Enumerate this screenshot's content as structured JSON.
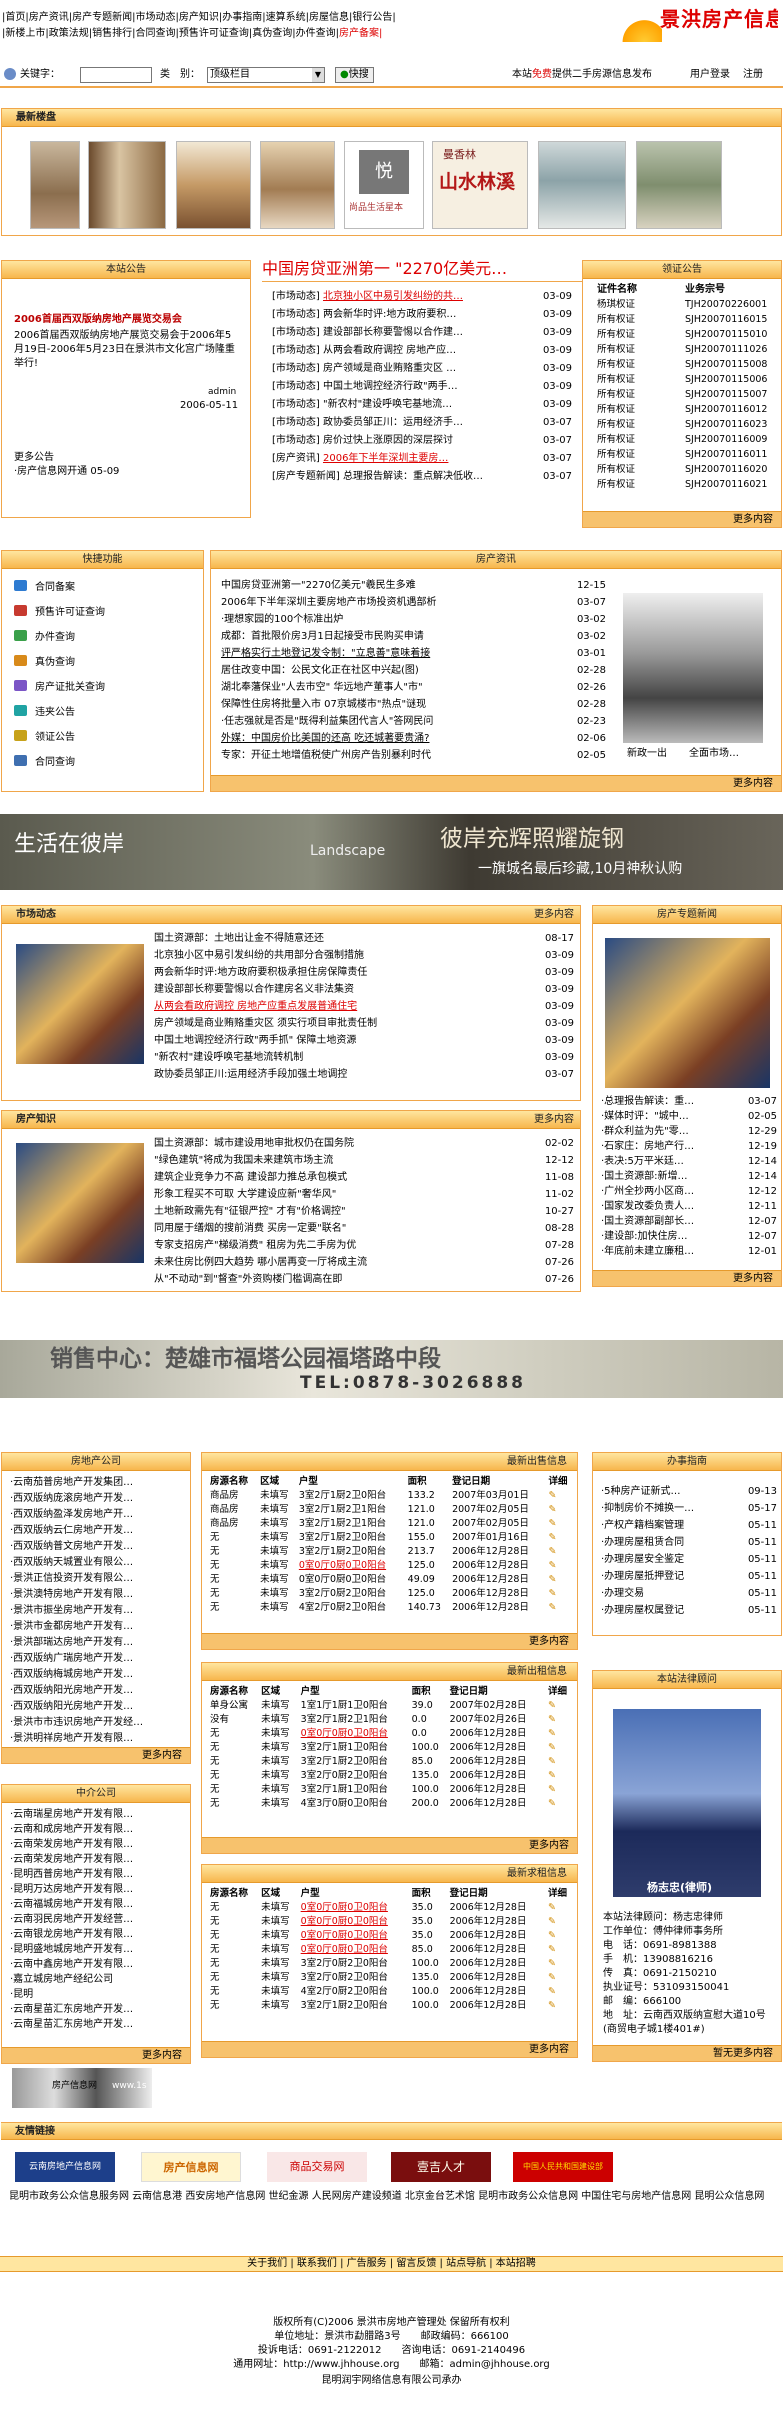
{
  "topnav": {
    "row1": "|首页|房产资讯|房产专题新闻|市场动态|房产知识|办事指南|速算系统|房屋信息|银行公告|",
    "row2": "|新楼上市|政策法规|销售排行|合同查询|预售许可证查询|真伪查询|办件查询|",
    "row2_red": "房产备案|"
  },
  "logo": {
    "text": "景洪房产信息网"
  },
  "search": {
    "keyword_label": "关键字：",
    "type_label": "类　别：",
    "select_value": "顶级栏目",
    "button": "快搜",
    "notice_pre": "本站",
    "notice_red": "免费",
    "notice_post": "提供二手房源信息发布",
    "links": [
      "用户登录",
      "注册"
    ]
  },
  "new_buildings": {
    "title": "最新楼盘",
    "ad_caption1": "尚品生活星本",
    "ad_caption2": "山水林溪",
    "ad_caption2_top": "曼香林"
  },
  "notice": {
    "title": "本站公告",
    "headline": "2006首届西双版纳房地产展览交易会",
    "text": "2006首届西双版纳房地产展览交易会于2006年5月19日-2006年5月23日在景洪市文化宫广场隆重举行!",
    "sign": "admin",
    "date": "2006-05-11",
    "more": "更多公告",
    "item": "·房产信息网开通 05-09"
  },
  "middle_news": {
    "title": "中国房贷亚洲第一 \"2270亿美元…",
    "items": [
      {
        "t": "[市场动态] ",
        "r": "北京独小区中易引发纠纷的共…",
        "d": "03-09"
      },
      {
        "t": "[市场动态] 两会新华时评:地方政府要积…",
        "r": "",
        "d": "03-09"
      },
      {
        "t": "[市场动态] 建设部部长称要警惕以合作建…",
        "r": "",
        "d": "03-09"
      },
      {
        "t": "[市场动态] 从两会看政府调控 房地产应…",
        "r": "",
        "d": "03-09"
      },
      {
        "t": "[市场动态] 房产领域是商业贿赂重灾区 …",
        "r": "",
        "d": "03-09"
      },
      {
        "t": "[市场动态] 中国土地调控经济行政\"两手…",
        "r": "",
        "d": "03-09"
      },
      {
        "t": "[市场动态] \"新农村\"建设呼唤宅基地流…",
        "r": "",
        "d": "03-09"
      },
      {
        "t": "[市场动态] 政协委员邹正川：运用经济手…",
        "r": "",
        "d": "03-07"
      },
      {
        "t": "[市场动态] 房价过快上涨原因的深层探讨",
        "r": "",
        "d": "03-07"
      },
      {
        "t": "[房产资讯] ",
        "r": "2006年下半年深圳主要房…",
        "d": "03-07"
      },
      {
        "t": "[房产专题新闻] 总理报告解读：重点解决低收…",
        "r": "",
        "d": "03-07"
      }
    ]
  },
  "certs": {
    "title": "领证公告",
    "h1": "证件名称",
    "h2": "业务宗号",
    "rows": [
      [
        "杨琪权证",
        "TJH20070226001"
      ],
      [
        "所有权证",
        "SJH20070116015"
      ],
      [
        "所有权证",
        "SJH20070115010"
      ],
      [
        "所有权证",
        "SJH20070111026"
      ],
      [
        "所有权证",
        "SJH20070115008"
      ],
      [
        "所有权证",
        "SJH20070115006"
      ],
      [
        "所有权证",
        "SJH20070115007"
      ],
      [
        "所有权证",
        "SJH20070116012"
      ],
      [
        "所有权证",
        "SJH20070116023"
      ],
      [
        "所有权证",
        "SJH20070116009"
      ],
      [
        "所有权证",
        "SJH20070116011"
      ],
      [
        "所有权证",
        "SJH20070116020"
      ],
      [
        "所有权证",
        "SJH20070116021"
      ]
    ],
    "more": "更多内容"
  },
  "quick": {
    "title": "快捷功能",
    "items": [
      "合同备案",
      "预售许可证查询",
      "办件查询",
      "真伪查询",
      "房产证批关查询",
      "违夹公告",
      "领证公告",
      "合同查询"
    ]
  },
  "fangchan_news": {
    "title": "房产资讯",
    "items": [
      {
        "t": "中国房贷亚洲第一\"2270亿美元\"羲民生多难",
        "d": "12-15"
      },
      {
        "t": "2006年下半年深圳主要房地产市场投资机遇部析",
        "d": "03-07"
      },
      {
        "t": "·理想家园的100个标准出炉",
        "d": "03-02"
      },
      {
        "t": "成都：首批限价房3月1日起接受市民购买申请",
        "d": "03-02"
      },
      {
        "t": "评严格实行土地登记发令制：\"立息善\"意味着接",
        "d": "03-01"
      },
      {
        "t": "居住改变中国：公民文化正在社区中兴起(图)",
        "d": "02-28"
      },
      {
        "t": "湖北奉藩保业\"人去市空\" 华远地产董事人\"市\"",
        "d": "02-26"
      },
      {
        "t": "保障性住房将批量入市 07京城楼市\"热点\"谜现",
        "d": "02-28"
      },
      {
        "t": "·任志强就是否是\"既得利益集团代言人\"答网民问",
        "d": "02-23"
      },
      {
        "t": "外媒：中国房价比美国的还高 吃还城著要贵涌?",
        "d": "02-06"
      },
      {
        "t": "专家：开征土地增值税使广州房产告别暴利时代",
        "d": "02-05"
      }
    ],
    "captions": [
      "新政一出",
      "全面市场…"
    ],
    "more": "更多内容"
  },
  "banner1": {
    "left": "生活在彼岸",
    "mid": "Landscape",
    "right_top": "彼岸充辉照耀旋钢",
    "right_bottom": "一旗城名最后珍藏,10月神秋认购"
  },
  "market": {
    "title": "市场动态",
    "more": "更多内容",
    "items": [
      {
        "t": "国土资源部：土地出让金不得随意还还",
        "d": "08-17"
      },
      {
        "t": "北京独小区中易引发纠纷的共用部分合强制措施",
        "d": "03-09"
      },
      {
        "t": "两会新华时评:地方政府要积极承担住房保障责任",
        "d": "03-09"
      },
      {
        "t": "建设部部长称要警惕以合作建房名义非法集资",
        "d": "03-09"
      },
      {
        "t": "从两会看政府调控 房地产应重点发展普通住宅",
        "d": "03-09",
        "red": true
      },
      {
        "t": "房产领域是商业贿赂重灾区 须实行项目审批责任制",
        "d": "03-09"
      },
      {
        "t": "中国土地调控经济行政\"两手抓\" 保障土地资源",
        "d": "03-09"
      },
      {
        "t": "\"新农村\"建设呼唤宅基地流转机制",
        "d": "03-09"
      },
      {
        "t": "政协委员邹正川:运用经济手段加强土地调控",
        "d": "03-07"
      }
    ]
  },
  "special": {
    "title": "房产专题新闻",
    "items": [
      {
        "t": "·总理报告解读：重…",
        "d": "03-07"
      },
      {
        "t": "·媒体时评：\"城中…",
        "d": "02-05"
      },
      {
        "t": "·群众利益为先\"零…",
        "d": "12-29"
      },
      {
        "t": "·石家庄：房地产行…",
        "d": "12-19"
      },
      {
        "t": "·表决:5万平米廷…",
        "d": "12-14"
      },
      {
        "t": "·国土资源部:新增…",
        "d": "12-14"
      },
      {
        "t": "·广州全抄两小区商…",
        "d": "12-12"
      },
      {
        "t": "·国家发改委负责人…",
        "d": "12-11"
      },
      {
        "t": "·国土资源部副部长…",
        "d": "12-07"
      },
      {
        "t": "·建设部:加快住房…",
        "d": "12-07"
      },
      {
        "t": "·年底前未建立廉租…",
        "d": "12-01"
      }
    ],
    "more": "更多内容"
  },
  "knowledge": {
    "title": "房产知识",
    "more": "更多内容",
    "items": [
      {
        "t": "国土资源部：城市建设用地审批权仍在国务院",
        "d": "02-02"
      },
      {
        "t": "\"绿色建筑\"将成为我国未来建筑市场主流",
        "d": "12-12"
      },
      {
        "t": "建筑企业竞争力不高 建设部力推总承包模式",
        "d": "11-08"
      },
      {
        "t": "形象工程买不可取 大学建设应新\"奢华风\"",
        "d": "11-02"
      },
      {
        "t": "土地新政需先有\"征银严控\" 才有\"价格调控\"",
        "d": "10-27"
      },
      {
        "t": "同用屋于缮烟的搜前消费 买房一定要\"联名\"",
        "d": "08-28"
      },
      {
        "t": "专家支招房产\"梯级消费\" 租房为先二手房为优",
        "d": "07-28"
      },
      {
        "t": "未来住房比例四大趋势 哪小居再变一厅将成主流",
        "d": "07-26"
      },
      {
        "t": "从\"不动动\"到\"督查\"外资购楼门槛调高在即",
        "d": "07-26"
      }
    ]
  },
  "banner2": {
    "text": "销售中心：楚雄市福塔公园福塔路中段",
    "tel": "TEL:0878-3026888"
  },
  "developers": {
    "title": "房地产公司",
    "more": "更多内容",
    "items": [
      "·云南茄普房地产开发集团…",
      "·西双版纳庞滚房地产开发…",
      "·西双版纳盈泽发房地产开…",
      "·西双版纳云仁房地产开发…",
      "·西双版纳普文房地产开发…",
      "·西双版纳天城置业有限公…",
      "·景洪正信投资开发有限公…",
      "·景洪澳特房地产开发有限…",
      "·景洪市振坐房地产开发有…",
      "·景洪市金都房地产开发有…",
      "·景洪部瑞达房地产开发有…",
      "·西双版纳广瑞房地产开发…",
      "·西双版纳梅城房地产开发…",
      "·西双版纳阳光房地产开发…",
      "·西双版纳阳光房地产开发…",
      "·景洪市市违识房地产开发经…",
      "·景洪明祥房地产开发有限…"
    ]
  },
  "agencies": {
    "title": "中介公司",
    "more": "更多内容",
    "items": [
      "·云南瑞星房地产开发有限…",
      "·云南和成房地产开发有限…",
      "·云南荣发房地产开发有限…",
      "·云南荣发房地产开发有限…",
      "·昆明西普房地产开发有限…",
      "·昆明万达房地产开发有限…",
      "·云南福城房地产开发有限…",
      "·云南羽民房地产开发经营…",
      "·云南银龙房地产开发有限…",
      "·昆明盛地城房地产开发有…",
      "·云南中鑫房地产开发有限…",
      "·嘉立城房地产经纪公司",
      "·昆明",
      "·云南星苗汇东房地产开发…",
      "·云南星苗汇东房地产开发…"
    ]
  },
  "sale": {
    "title": "最新出售信息",
    "more": "更多内容",
    "cols": [
      "房源名称",
      "区域",
      "户型",
      "面积",
      "登记日期",
      "详细"
    ],
    "rows": [
      [
        "商品房",
        "未填写",
        "3室2厅1厨2卫0阳台",
        "133.2",
        "2007年03月01日"
      ],
      [
        "商品房",
        "未填写",
        "3室2厅1厨2卫1阳台",
        "121.0",
        "2007年02月05日"
      ],
      [
        "商品房",
        "未填写",
        "3室2厅1厨2卫1阳台",
        "121.0",
        "2007年02月05日"
      ],
      [
        "无",
        "未填写",
        "3室2厅1厨2卫0阳台",
        "155.0",
        "2007年01月16日"
      ],
      [
        "无",
        "未填写",
        "3室2厅1厨2卫0阳台",
        "213.7",
        "2006年12月28日"
      ],
      [
        "无",
        "未填写",
        "0室0厅0厨0卫0阳台",
        "125.0",
        "2006年12月28日"
      ],
      [
        "无",
        "未填写",
        "0室0厅0厨0卫0阳台",
        "49.09",
        "2006年12月28日"
      ],
      [
        "无",
        "未填写",
        "3室2厅0厨2卫0阳台",
        "125.0",
        "2006年12月28日"
      ],
      [
        "无",
        "未填写",
        "4室2厅0厨2卫0阳台",
        "140.73",
        "2006年12月28日"
      ]
    ],
    "red_rows": [
      5
    ]
  },
  "rent": {
    "title": "最新出租信息",
    "more": "更多内容",
    "cols": [
      "房源名称",
      "区域",
      "户型",
      "面积",
      "登记日期",
      "详细"
    ],
    "rows": [
      [
        "单身公寓",
        "未填写",
        "1室1厅1厨1卫0阳台",
        "39.0",
        "2007年02月28日"
      ],
      [
        "没有",
        "未填写",
        "3室2厅1厨2卫1阳台",
        "0.0",
        "2007年02月26日"
      ],
      [
        "无",
        "未填写",
        "0室0厅0厨0卫0阳台",
        "0.0",
        "2006年12月28日"
      ],
      [
        "无",
        "未填写",
        "3室2厅1厨1卫0阳台",
        "100.0",
        "2006年12月28日"
      ],
      [
        "无",
        "未填写",
        "3室2厅1厨2卫0阳台",
        "85.0",
        "2006年12月28日"
      ],
      [
        "无",
        "未填写",
        "3室2厅0厨2卫0阳台",
        "135.0",
        "2006年12月28日"
      ],
      [
        "无",
        "未填写",
        "3室2厅1厨1卫0阳台",
        "100.0",
        "2006年12月28日"
      ],
      [
        "无",
        "未填写",
        "4室3厅0厨0卫0阳台",
        "200.0",
        "2006年12月28日"
      ]
    ],
    "red_rows": [
      2
    ]
  },
  "buy": {
    "title": "最新求租信息",
    "more": "更多内容",
    "cols": [
      "房源名称",
      "区域",
      "户型",
      "面积",
      "登记日期",
      "详细"
    ],
    "rows": [
      [
        "无",
        "未填写",
        "0室0厅0厨0卫0阳台",
        "35.0",
        "2006年12月28日"
      ],
      [
        "无",
        "未填写",
        "0室0厅0厨0卫0阳台",
        "35.0",
        "2006年12月28日"
      ],
      [
        "无",
        "未填写",
        "0室0厅0厨0卫0阳台",
        "35.0",
        "2006年12月28日"
      ],
      [
        "无",
        "未填写",
        "0室0厅0厨0卫0阳台",
        "85.0",
        "2006年12月28日"
      ],
      [
        "无",
        "未填写",
        "3室2厅0厨2卫0阳台",
        "100.0",
        "2006年12月28日"
      ],
      [
        "无",
        "未填写",
        "3室2厅0厨2卫0阳台",
        "135.0",
        "2006年12月28日"
      ],
      [
        "无",
        "未填写",
        "4室2厅0厨2卫0阳台",
        "100.0",
        "2006年12月28日"
      ],
      [
        "无",
        "未填写",
        "3室2厅1厨2卫0阳台",
        "100.0",
        "2006年12月28日"
      ]
    ],
    "red_rows": [
      0,
      1,
      2,
      3
    ]
  },
  "guide": {
    "title": "办事指南",
    "items": [
      {
        "t": "·5种房产证新式…",
        "d": "09-13"
      },
      {
        "t": "·抑制房价不摊换一…",
        "d": "05-17"
      },
      {
        "t": "·产权产籍档案管理",
        "d": "05-11"
      },
      {
        "t": "·办理房屋租赁合同",
        "d": "05-11"
      },
      {
        "t": "·办理房屋安全鉴定",
        "d": "05-11"
      },
      {
        "t": "·办理房屋抵押登记",
        "d": "05-11"
      },
      {
        "t": "·办理交易",
        "d": "05-11"
      },
      {
        "t": "·办理房屋权属登记",
        "d": "05-11"
      }
    ]
  },
  "lawyer": {
    "title": "本站法律顾问",
    "name_caption": "杨志忠(律师)",
    "lines": [
      "本站法律顾问：杨志忠律师",
      "工作单位：傅仲律师事务所",
      "电　话：0691-8981388",
      "手　机：13908816216",
      "传　真：0691-2150210",
      "执业证号：531093150041",
      "邮　编：666100",
      "地　址：云南西双版纳宣慰大道10号(商贸电子城1楼401#)"
    ],
    "more": "暂无更多内容"
  },
  "small_banner": {
    "text": "房产信息网",
    "text2": "www.1s"
  },
  "links": {
    "title": "友情链接",
    "logos": [
      "云南房地产信息网",
      "房产信息网",
      "商品交易网",
      "壹吉人才",
      "中国人民共和国建设部"
    ],
    "text": "昆明市政务公众信息服务网 云南信息港 西安房地产信息网 世纪金源 人民网房产建设频道 北京金台艺术馆 昆明市政务公众信息网 中国住宅与房地产信息网 昆明公众信息网"
  },
  "footer_links": "关于我们 | 联系我们 | 广告服务 | 留言反馈 | 站点导航 | 本站招聘",
  "copyright": {
    "l1": "版权所有(C)2006 景洪市房地产管理处 保留所有权利",
    "l2": "单位地址：景洪市勐腊路3号　　邮政编码：666100",
    "l3": "投诉电话：0691-2122012　　咨询电话：0691-2140496",
    "l4": "通用网址：http://www.jhhouse.org　　邮箱：admin@jhhouse.org",
    "l5": "昆明润宇网络信息有限公司承办"
  },
  "colors": {
    "header_orange": "#f7b64d",
    "border": "#f0a64a",
    "accent_red": "#d00"
  }
}
